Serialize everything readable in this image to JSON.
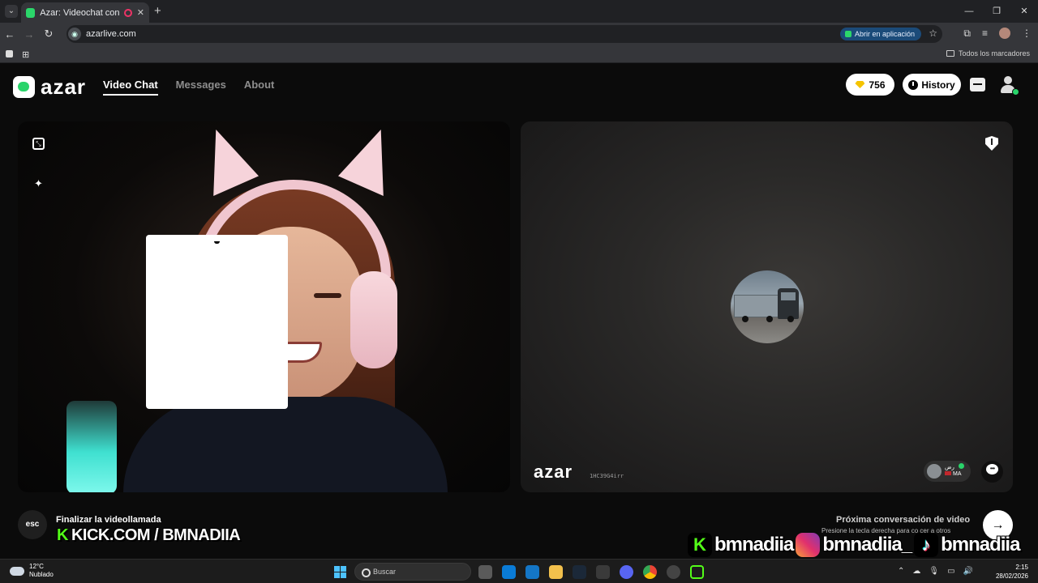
{
  "browser": {
    "tab_title": "Azar: Videochat con gente",
    "new_tab": "+",
    "url": "azarlive.com",
    "open_app_label": "Abrir en aplicación",
    "bookmarks_all": "Todos los marcadores"
  },
  "app": {
    "logo": "azar",
    "nav": [
      {
        "label": "Video Chat",
        "active": true
      },
      {
        "label": "Messages",
        "active": false
      },
      {
        "label": "About",
        "active": false
      }
    ],
    "gems": "756",
    "history_label": "History"
  },
  "remote": {
    "logo": "azar",
    "session_id": "1HC39G4irr",
    "peer_name": "رض",
    "peer_country": "MA"
  },
  "controls": {
    "esc_label": "esc",
    "end_call_label": "Finalizar la videollamada",
    "next_title": "Próxima conversación de video",
    "next_hint": "Presione la tecla derecha para co  cer a otros",
    "next_arrow": "→"
  },
  "overlays": {
    "kick_label": "KICK.COM / BMNADIIA",
    "kick_k": "K",
    "socials": [
      {
        "platform": "kick",
        "name": "bmnadiia"
      },
      {
        "platform": "instagram",
        "name": "bmnadiia_"
      },
      {
        "platform": "tiktok",
        "name": "bmnadiia"
      }
    ]
  },
  "taskbar": {
    "temp": "12°C",
    "weather": "Nublado",
    "search_placeholder": "Buscar",
    "time": "2:15",
    "date": "28/02/2026"
  },
  "colors": {
    "brand_green": "#29d46a",
    "kick_green": "#53fc18",
    "open_app_bg": "#1b4b79"
  }
}
